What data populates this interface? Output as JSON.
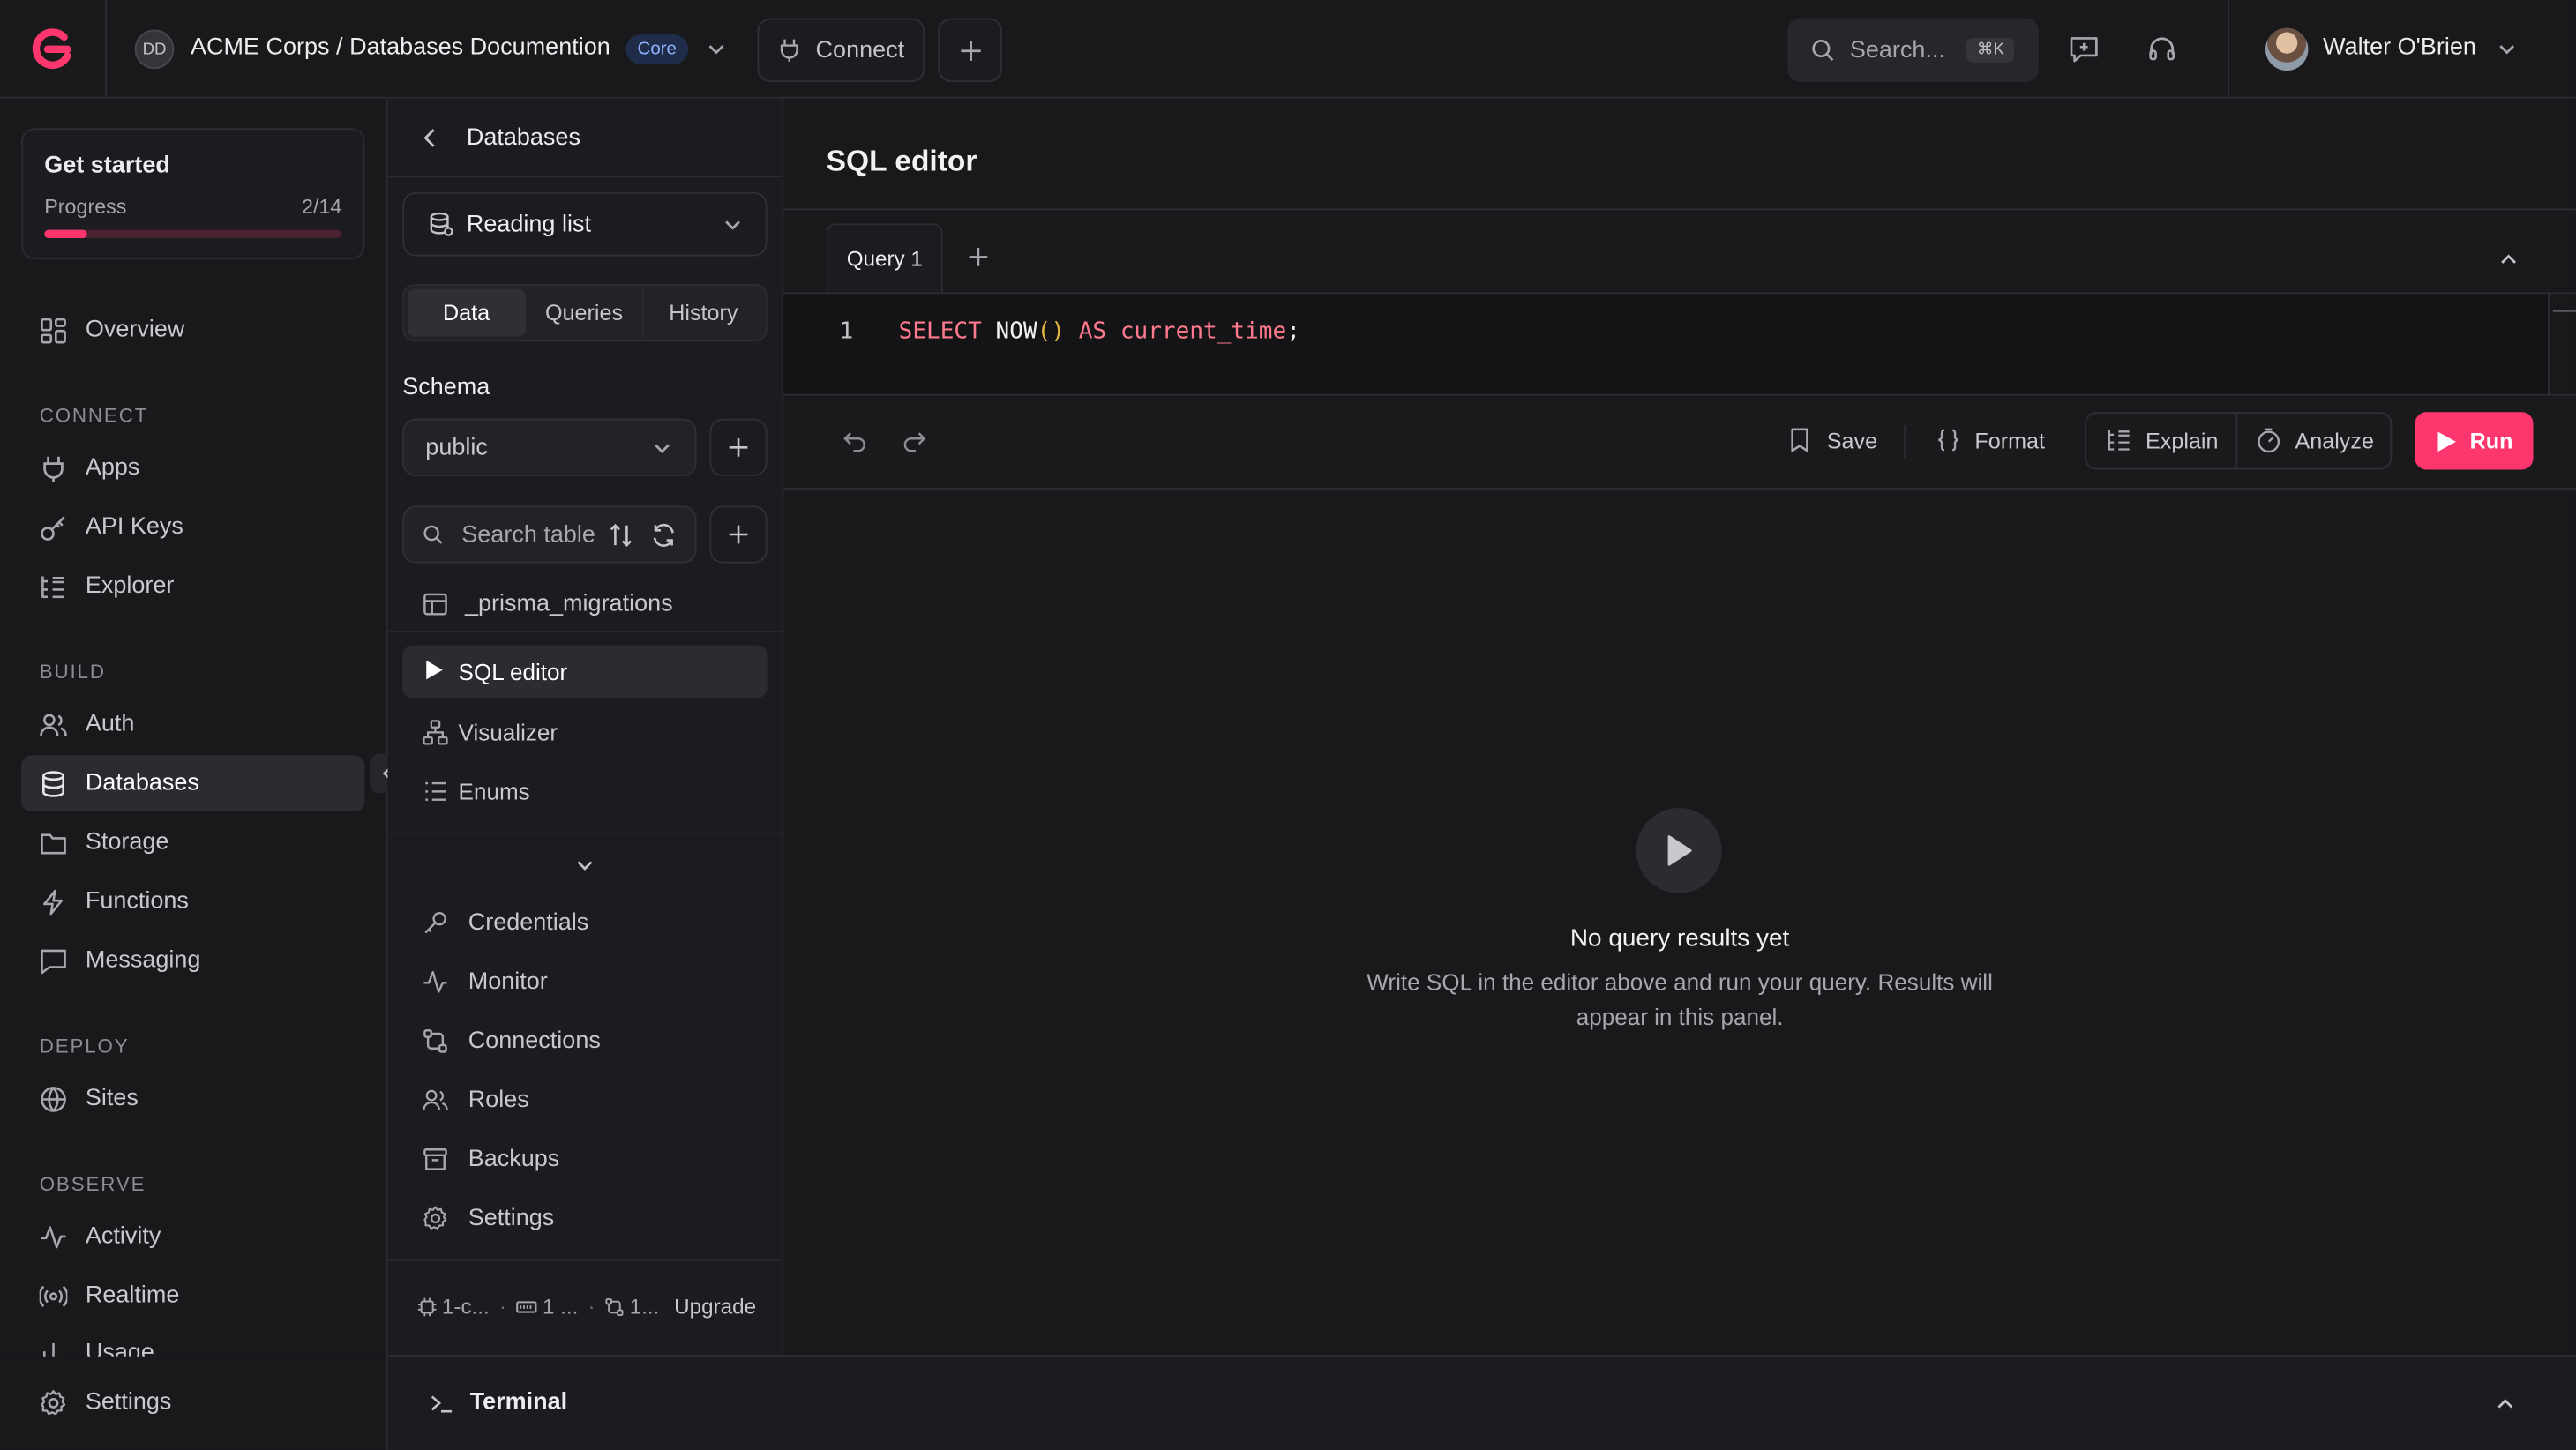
{
  "header": {
    "org_initials": "DD",
    "project_title": "ACME Corps / Databases Documention",
    "plan_badge": "Core",
    "connect_label": "Connect",
    "search_placeholder": "Search...",
    "search_shortcut": "⌘K",
    "user_name": "Walter O'Brien"
  },
  "get_started": {
    "title": "Get started",
    "progress_label": "Progress",
    "progress_text": "2/14",
    "progress_fraction": 0.143
  },
  "nav": {
    "overview": "Overview",
    "sections": {
      "connect": "CONNECT",
      "build": "BUILD",
      "deploy": "DEPLOY",
      "observe": "OBSERVE"
    },
    "connect_items": [
      "Apps",
      "API Keys",
      "Explorer"
    ],
    "build_items": [
      "Auth",
      "Databases",
      "Storage",
      "Functions",
      "Messaging"
    ],
    "deploy_items": [
      "Sites"
    ],
    "observe_items": [
      "Activity",
      "Realtime",
      "Usage"
    ],
    "settings": "Settings"
  },
  "db_panel": {
    "back_title": "Databases",
    "database_select": "Reading list",
    "tabs": [
      "Data",
      "Queries",
      "History"
    ],
    "active_tab": "Data",
    "schema_label": "Schema",
    "schema_value": "public",
    "search_placeholder": "Search table",
    "tables": [
      "_prisma_migrations"
    ],
    "tools": [
      "SQL editor",
      "Visualizer",
      "Enums"
    ],
    "links": [
      "Credentials",
      "Monitor",
      "Connections",
      "Roles",
      "Backups",
      "Settings"
    ],
    "footer": {
      "cpu": "1-c...",
      "memory": "1 ...",
      "connections": "1...",
      "upgrade": "Upgrade"
    }
  },
  "editor": {
    "title": "SQL editor",
    "query_tab": "Query 1",
    "line_number": "1",
    "code": {
      "kw1": "SELECT",
      "fn": "NOW",
      "paren": "()",
      "kw2": "AS",
      "ident": "current_time",
      "end": ";"
    },
    "toolbar": {
      "save": "Save",
      "format": "Format",
      "explain": "Explain",
      "analyze": "Analyze",
      "run": "Run"
    },
    "empty_title": "No query results yet",
    "empty_line1": "Write SQL in the editor above and run your query. Results will",
    "empty_line2": "appear in this panel."
  },
  "terminal": {
    "label": "Terminal"
  },
  "colors": {
    "accent": "#fd366e",
    "background": "#19191c",
    "panel": "#1c1c20",
    "code_keyword": "#ff7a8f",
    "code_paren": "#e3b341"
  }
}
